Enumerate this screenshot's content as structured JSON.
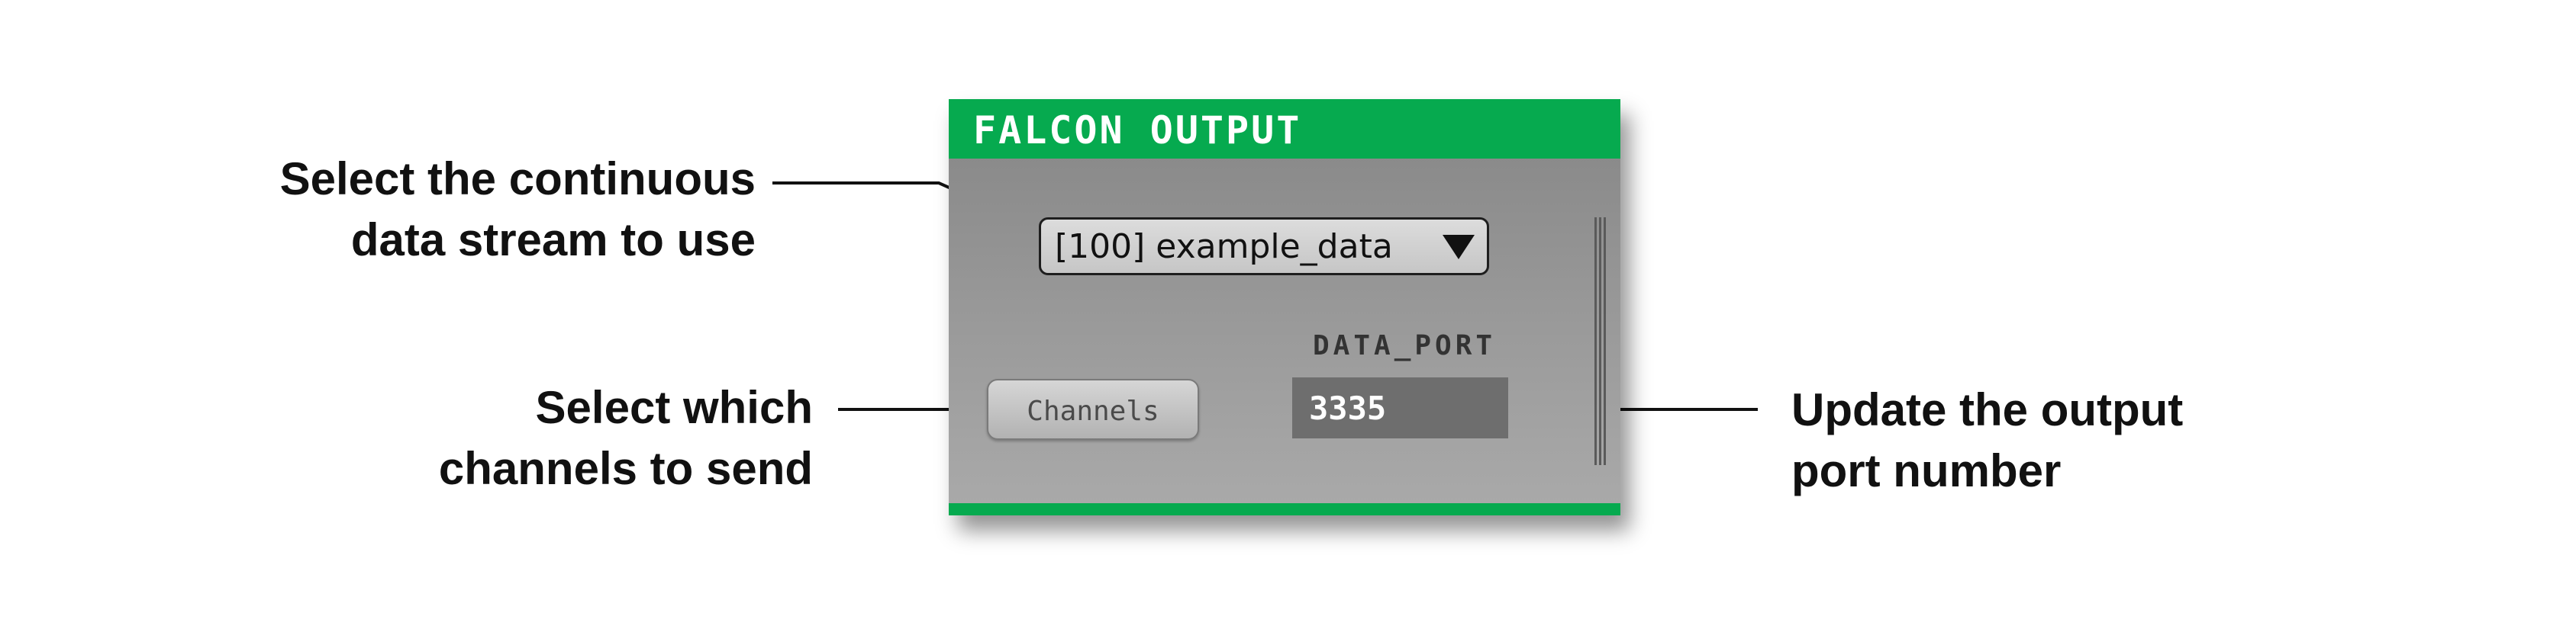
{
  "panel": {
    "title": "FALCON OUTPUT",
    "stream_select": {
      "selected": "[100] example_data"
    },
    "port_label": "DATA_PORT",
    "port_value": "3335",
    "channels_button": "Channels"
  },
  "annotations": {
    "stream": {
      "line1": "Select the continuous",
      "line2": "data stream to use"
    },
    "channels": {
      "line1": "Select which",
      "line2": "channels to send"
    },
    "port": {
      "line1": "Update the output",
      "line2": "port number"
    }
  },
  "colors": {
    "accent": "#06aa4f",
    "panel": "#9a9a9a",
    "field": "#6e6e6e"
  },
  "icons": {
    "dropdown": "triangle-down-icon"
  }
}
